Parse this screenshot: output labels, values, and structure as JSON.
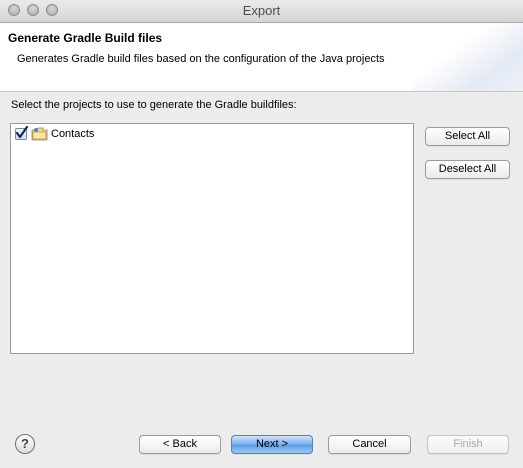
{
  "window": {
    "title": "Export"
  },
  "banner": {
    "title": "Generate Gradle Build files",
    "description": "Generates Gradle build files based on the configuration of the Java projects"
  },
  "projects": {
    "prompt": "Select the projects to use to generate the Gradle buildfiles:",
    "items": [
      {
        "label": "Contacts",
        "checked": true,
        "icon": "java-project-folder-icon"
      }
    ]
  },
  "side_buttons": {
    "select_all": "Select All",
    "deselect_all": "Deselect All"
  },
  "footer": {
    "help_glyph": "?",
    "back": "< Back",
    "next": "Next >",
    "cancel": "Cancel",
    "finish": "Finish"
  },
  "colors": {
    "accent": "#5c9be6",
    "disabled_text": "#a8a8a8"
  }
}
